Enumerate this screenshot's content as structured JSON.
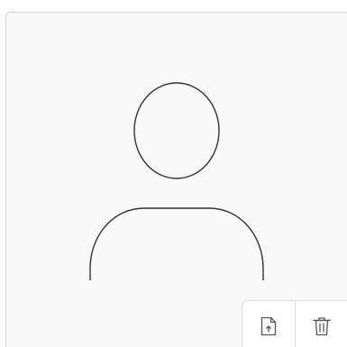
{
  "avatar": {
    "placeholder_icon": "person-placeholder-icon",
    "background": "#f9f9f9",
    "border_color": "#d4d4d0",
    "stroke_color": "#333333"
  },
  "actions": [
    {
      "name": "upload",
      "icon": "file-upload-icon"
    },
    {
      "name": "delete",
      "icon": "trash-icon"
    }
  ]
}
